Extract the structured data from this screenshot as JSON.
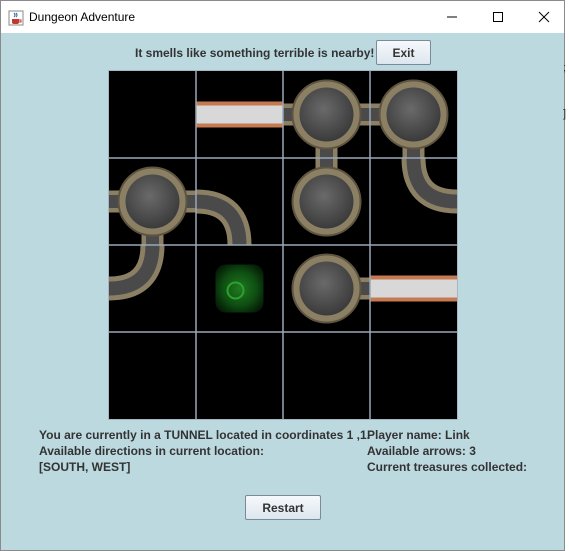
{
  "window": {
    "title": "Dungeon Adventure"
  },
  "status": {
    "message": "It smells like something terrible is nearby!"
  },
  "buttons": {
    "exit": "Exit",
    "restart": "Restart"
  },
  "board": {
    "rows": 4,
    "cols": 4,
    "cells": [
      {
        "row": 0,
        "col": 0,
        "kind": "empty"
      },
      {
        "row": 0,
        "col": 1,
        "kind": "tunnel",
        "exits": [
          "east",
          "west"
        ]
      },
      {
        "row": 0,
        "col": 2,
        "kind": "cave",
        "exits": [
          "east",
          "south",
          "west"
        ]
      },
      {
        "row": 0,
        "col": 3,
        "kind": "cave",
        "exits": [
          "south",
          "west"
        ]
      },
      {
        "row": 1,
        "col": 0,
        "kind": "cave",
        "exits": [
          "east",
          "south",
          "west"
        ]
      },
      {
        "row": 1,
        "col": 1,
        "kind": "tunnel",
        "exits": [
          "south",
          "west"
        ],
        "current": true
      },
      {
        "row": 1,
        "col": 2,
        "kind": "cave",
        "exits": [
          "north"
        ]
      },
      {
        "row": 1,
        "col": 3,
        "kind": "tunnel",
        "exits": [
          "north",
          "east"
        ]
      },
      {
        "row": 2,
        "col": 0,
        "kind": "tunnel",
        "exits": [
          "north",
          "west"
        ]
      },
      {
        "row": 2,
        "col": 1,
        "kind": "slime"
      },
      {
        "row": 2,
        "col": 2,
        "kind": "cave",
        "exits": [
          "east"
        ]
      },
      {
        "row": 2,
        "col": 3,
        "kind": "tunnel",
        "exits": [
          "east",
          "west"
        ]
      },
      {
        "row": 3,
        "col": 0,
        "kind": "empty"
      },
      {
        "row": 3,
        "col": 1,
        "kind": "empty"
      },
      {
        "row": 3,
        "col": 2,
        "kind": "empty"
      },
      {
        "row": 3,
        "col": 3,
        "kind": "empty"
      }
    ]
  },
  "location": {
    "line1": "You are currently in a TUNNEL located in coordinates 1 ,1.",
    "line2": "Available directions in current location:",
    "line3": "[SOUTH, WEST]"
  },
  "player": {
    "name": "Player name: Link",
    "arrows": "Available arrows: 3",
    "treasures": "Current treasures collected:"
  },
  "colors": {
    "background": "#bcd9e0",
    "floor": "#4a4a4a",
    "stone": "#8c8064",
    "corridor": "#c67a52"
  },
  "icons": {
    "app": "java-cup-icon",
    "minimize": "minimize-icon",
    "maximize": "maximize-icon",
    "close": "close-icon"
  },
  "stray_glyphs": [
    ";",
    "]"
  ]
}
